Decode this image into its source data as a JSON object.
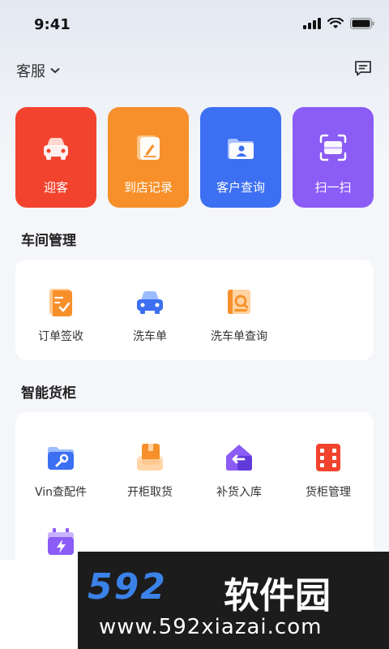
{
  "status": {
    "time": "9:41"
  },
  "header": {
    "service_label": "客服"
  },
  "quick_actions": [
    {
      "label": "迎客",
      "color": "#f2432e",
      "icon": "car-icon"
    },
    {
      "label": "到店记录",
      "color": "#f7902a",
      "icon": "record-icon"
    },
    {
      "label": "客户查询",
      "color": "#3d6ff2",
      "icon": "customer-icon"
    },
    {
      "label": "扫一扫",
      "color": "#8b5cf6",
      "icon": "scan-icon"
    }
  ],
  "workshop": {
    "title": "车间管理",
    "items": [
      {
        "label": "订单签收",
        "icon": "order-sign-icon"
      },
      {
        "label": "洗车单",
        "icon": "car-wash-icon"
      },
      {
        "label": "洗车单查询",
        "icon": "car-wash-search-icon"
      }
    ]
  },
  "smart_cabinet": {
    "title": "智能货柜",
    "items": [
      {
        "label": "Vin查配件",
        "icon": "wrench-folder-icon"
      },
      {
        "label": "开柜取货",
        "icon": "box-icon"
      },
      {
        "label": "补货入库",
        "icon": "restock-icon"
      },
      {
        "label": "货柜管理",
        "icon": "cabinet-icon"
      },
      {
        "label": "",
        "icon": "charge-icon"
      }
    ]
  },
  "watermark": {
    "brand_num": "592",
    "brand_cn": "软件园",
    "url": "www.592xiazai.com"
  }
}
